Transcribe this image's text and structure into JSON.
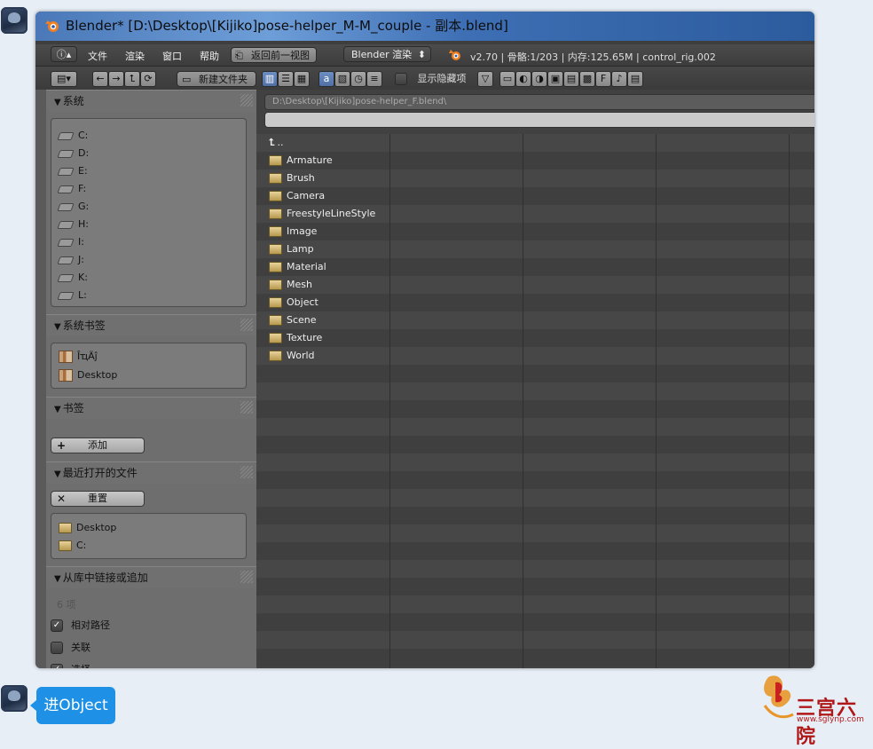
{
  "window": {
    "title": "Blender* [D:\\Desktop\\[Kijiko]pose-helper_M-M_couple - 副本.blend]"
  },
  "menubar": {
    "menus": [
      "文件",
      "渲染",
      "窗口",
      "帮助"
    ],
    "back_label": "返回前一视图",
    "engine_label": "Blender 渲染",
    "status": "v2.70 | 骨骼:1/203  | 内存:125.65M | control_rig.002"
  },
  "toolbar": {
    "new_folder_label": "新建文件夹",
    "show_hidden_label": "显示隐藏项"
  },
  "sidebar": {
    "system": {
      "title": "系统",
      "drives": [
        "C:",
        "D:",
        "E:",
        "F:",
        "G:",
        "H:",
        "I:",
        "J:",
        "K:",
        "L:"
      ]
    },
    "system_bookmarks": {
      "title": "系统书签",
      "items": [
        "ÎҵÄĵ",
        "Desktop"
      ]
    },
    "bookmarks": {
      "title": "书签",
      "add_label": "添加"
    },
    "recent": {
      "title": "最近打开的文件",
      "reset_label": "重置",
      "items": [
        "Desktop",
        "C:"
      ]
    },
    "link_append": {
      "title": "从库中链接或追加",
      "count_label": "6 项",
      "relative_path_label": "相对路径",
      "relative_path_checked": true,
      "link_label": "关联",
      "link_checked": false,
      "select_label": "选择",
      "select_checked": true
    }
  },
  "file_browser": {
    "path": "D:\\Desktop\\[Kijiko]pose-helper_F.blend\\",
    "filename": "",
    "parent_label": "..",
    "entries": [
      "Armature",
      "Brush",
      "Camera",
      "FreestyleLineStyle",
      "Image",
      "Lamp",
      "Material",
      "Mesh",
      "Object",
      "Scene",
      "Texture",
      "World"
    ]
  },
  "chat": {
    "message": "进Object"
  },
  "watermark": {
    "text": "三宫六院",
    "url": "www.sglynp.com"
  }
}
